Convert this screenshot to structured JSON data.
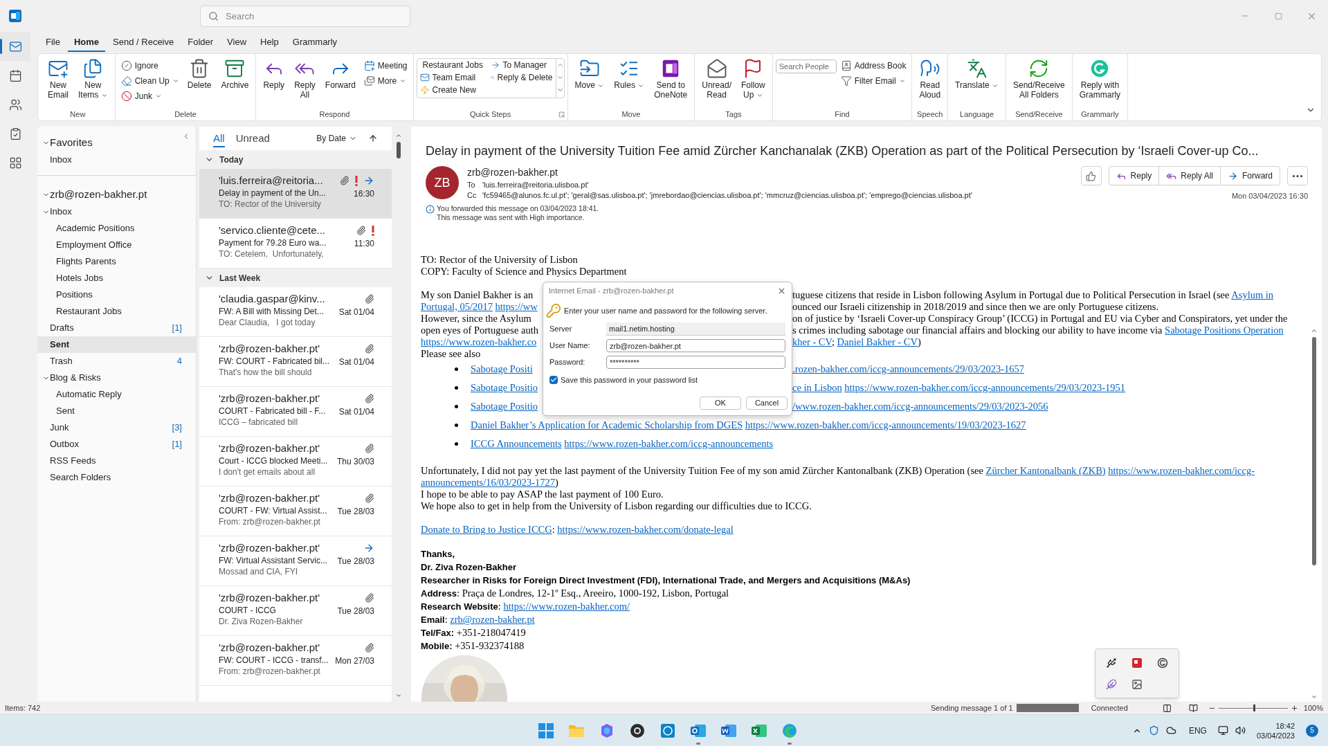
{
  "title_bar": {
    "search": {
      "placeholder": "Search"
    }
  },
  "app_rail": [
    {
      "selected": true
    },
    {
      "selected": false
    },
    {
      "selected": false
    },
    {
      "selected": false
    },
    {
      "selected": false
    }
  ],
  "menu_tabs": [
    {
      "label": "File",
      "selected": false
    },
    {
      "label": "Home",
      "selected": true
    },
    {
      "label": "Send / Receive",
      "selected": false
    },
    {
      "label": "Folder",
      "selected": false
    },
    {
      "label": "View",
      "selected": false
    },
    {
      "label": "Help",
      "selected": false
    },
    {
      "label": "Grammarly",
      "selected": false
    }
  ],
  "ribbon": [
    {
      "label": "New",
      "items": [
        {
          "kind": "large",
          "label": "New\nEmail"
        },
        {
          "kind": "large",
          "label": "New\nItems",
          "dropdown": true
        }
      ]
    },
    {
      "label": "Delete",
      "items": [
        {
          "kind": "stack",
          "buttons": [
            {
              "label": "Ignore"
            },
            {
              "label": "Clean Up",
              "dropdown": true
            },
            {
              "label": "Junk",
              "dropdown": true
            }
          ]
        },
        {
          "kind": "large",
          "label": "Delete"
        },
        {
          "kind": "large",
          "label": "Archive"
        }
      ]
    },
    {
      "label": "Respond",
      "items": [
        {
          "kind": "large",
          "label": "Reply"
        },
        {
          "kind": "large",
          "label": "Reply\nAll"
        },
        {
          "kind": "large",
          "label": "Forward"
        },
        {
          "kind": "stack",
          "buttons": [
            {
              "label": "Meeting"
            },
            {
              "label": "More",
              "dropdown": true
            }
          ]
        }
      ]
    },
    {
      "label": "Quick Steps",
      "launcher": true,
      "items": [
        {
          "kind": "gallery",
          "cells": [
            {
              "label": "Restaurant Jobs"
            },
            {
              "label": "To Manager"
            },
            {
              "label": "Team Email"
            },
            {
              "label": "Reply & Delete"
            },
            {
              "label": "Create New"
            }
          ]
        }
      ]
    },
    {
      "label": "Move",
      "items": [
        {
          "kind": "large",
          "label": "Move",
          "dropdown": true
        },
        {
          "kind": "large",
          "label": "Rules",
          "dropdown": true
        },
        {
          "kind": "large",
          "label": "Send to\nOneNote"
        }
      ]
    },
    {
      "label": "Tags",
      "items": [
        {
          "kind": "large",
          "label": "Unread/\nRead"
        },
        {
          "kind": "large",
          "label": "Follow\nUp",
          "dropdown": true
        }
      ]
    },
    {
      "label": "Find",
      "items": [
        {
          "kind": "search",
          "placeholder": "Search People"
        },
        {
          "kind": "stack",
          "buttons": [
            {
              "label": "Address Book"
            },
            {
              "label": "Filter Email",
              "dropdown": true
            }
          ]
        }
      ]
    },
    {
      "label": "Speech",
      "items": [
        {
          "kind": "large",
          "label": "Read\nAloud"
        }
      ]
    },
    {
      "label": "Language",
      "items": [
        {
          "kind": "large",
          "label": "Translate",
          "dropdown": true
        }
      ]
    },
    {
      "label": "Send/Receive",
      "items": [
        {
          "kind": "large",
          "label": "Send/Receive\nAll Folders"
        }
      ]
    },
    {
      "label": "Grammarly",
      "items": [
        {
          "kind": "large",
          "label": "Reply with\nGrammarly"
        }
      ]
    }
  ],
  "folders": {
    "sections": [
      {
        "label": "Favorites",
        "expanded": true,
        "children": [
          {
            "label": "Inbox",
            "selected": false
          }
        ]
      },
      {
        "label": "zrb@rozen-bakher.pt",
        "expanded": true,
        "children": [
          {
            "label": "Inbox",
            "selected": false,
            "expanded": true,
            "children": [
              {
                "label": "Academic Positions",
                "selected": false
              },
              {
                "label": "Employment Office",
                "selected": false
              },
              {
                "label": "Flights Parents",
                "selected": false
              },
              {
                "label": "Hotels Jobs",
                "selected": false
              },
              {
                "label": "Positions",
                "selected": false
              },
              {
                "label": "Restaurant Jobs",
                "selected": false
              }
            ]
          },
          {
            "label": "Drafts",
            "count": "[1]",
            "selected": false
          },
          {
            "label": "Sent",
            "selected": true
          },
          {
            "label": "Trash",
            "count": "4",
            "selected": false
          },
          {
            "label": "Blog & Risks",
            "selected": false,
            "expanded": true,
            "children": [
              {
                "label": "Automatic Reply",
                "selected": false
              },
              {
                "label": "Sent",
                "selected": false
              }
            ]
          },
          {
            "label": "Junk",
            "count": "[3]",
            "selected": false
          },
          {
            "label": "Outbox",
            "count": "[1]",
            "selected": false
          },
          {
            "label": "RSS Feeds",
            "selected": false
          },
          {
            "label": "Search Folders",
            "selected": false
          }
        ]
      }
    ]
  },
  "message_list": {
    "filters": [
      {
        "label": "All",
        "selected": true
      },
      {
        "label": "Unread",
        "selected": false
      }
    ],
    "sort": "By Date",
    "groups": [
      {
        "label": "Today",
        "expanded": true,
        "messages": [
          {
            "sender": "'luis.ferreira@reitoria...",
            "subject": "Delay in payment of the Un...",
            "preview": "TO: Rector of the University",
            "time": "16:30",
            "attachment": true,
            "important": true,
            "forwarded": true,
            "selected": true
          },
          {
            "sender": "'servico.cliente@cete...",
            "subject": "Payment for 79.28 Euro wa...",
            "preview": "TO: Cetelem,  Unfortunately,",
            "time": "11:30",
            "attachment": true,
            "important": true,
            "forwarded": false,
            "selected": false
          }
        ]
      },
      {
        "label": "Last Week",
        "expanded": true,
        "messages": [
          {
            "sender": "'claudia.gaspar@kinv...",
            "subject": "FW: A Bill with Missing Det...",
            "preview": "Dear Claudia,   I got today",
            "time": "Sat 01/04",
            "attachment": true,
            "important": false,
            "forwarded": false,
            "selected": false
          },
          {
            "sender": "'zrb@rozen-bakher.pt'",
            "subject": "FW: COURT - Fabricated bil...",
            "preview": "That's how the bill should",
            "time": "Sat 01/04",
            "attachment": true,
            "important": false,
            "forwarded": false,
            "selected": false
          },
          {
            "sender": "'zrb@rozen-bakher.pt'",
            "subject": "COURT - Fabricated bill - F...",
            "preview": "ICCG – fabricated bill",
            "time": "Sat 01/04",
            "attachment": true,
            "important": false,
            "forwarded": false,
            "selected": false
          },
          {
            "sender": "'zrb@rozen-bakher.pt'",
            "subject": "Court - ICCG blocked Meeti...",
            "preview": "I don't get emails about all",
            "time": "Thu 30/03",
            "attachment": true,
            "important": false,
            "forwarded": false,
            "selected": false
          },
          {
            "sender": "'zrb@rozen-bakher.pt'",
            "subject": "COURT - FW: Virtual Assist...",
            "preview": "From: zrb@rozen-bakher.pt",
            "time": "Tue 28/03",
            "attachment": true,
            "important": false,
            "forwarded": false,
            "selected": false
          },
          {
            "sender": "'zrb@rozen-bakher.pt'",
            "subject": "FW: Virtual Assistant Servic...",
            "preview": "Mossad and CIA, FYI",
            "time": "Tue 28/03",
            "attachment": false,
            "important": false,
            "forwarded": true,
            "selected": false
          },
          {
            "sender": "'zrb@rozen-bakher.pt'",
            "subject": "COURT - ICCG",
            "preview": "Dr. Ziva Rozen-Bakher",
            "time": "Tue 28/03",
            "attachment": true,
            "important": false,
            "forwarded": false,
            "selected": false
          },
          {
            "sender": "'zrb@rozen-bakher.pt'",
            "subject": "FW: COURT - ICCG - transf...",
            "preview": "From: zrb@rozen-bakher.pt",
            "time": "Mon 27/03",
            "attachment": true,
            "important": false,
            "forwarded": false,
            "selected": false
          }
        ]
      }
    ]
  },
  "reading_pane": {
    "subject": "Delay in payment of the University Tuition Fee amid Zürcher Kanchanalak (ZKB) Operation as part of the Political Persecution by ‘Israeli Cover-up Co...",
    "avatar": "ZB",
    "from": "zrb@rozen-bakher.pt",
    "to_label": "To",
    "to": "'luis.ferreira@reitoria.ulisboa.pt'",
    "cc_label": "Cc",
    "cc": "'fc59465@alunos.fc.ul.pt'; 'geral@sas.ulisboa.pt'; 'jmrebordao@ciencias.ulisboa.pt'; 'mmcruz@ciencias.ulisboa.pt'; 'emprego@ciencias.ulisboa.pt'",
    "date": "Mon 03/04/2023 16:30",
    "info": [
      "You forwarded this message on 03/04/2023 18:41.",
      "This message was sent with High importance."
    ],
    "actions": [
      {
        "label": "Reply"
      },
      {
        "label": "Reply All"
      },
      {
        "label": "Forward"
      }
    ],
    "body": [
      {
        "kind": "line",
        "left": [
          {
            "kind": "plain",
            "t": "TO: Rector of the University of Lisbon"
          }
        ]
      },
      {
        "kind": "line",
        "left": [
          {
            "kind": "plain",
            "t": "COPY: Faculty of Science and Physics Department"
          }
        ]
      },
      {
        "kind": "gap"
      },
      {
        "kind": "line",
        "left": [
          {
            "kind": "plain",
            "t": "My son Daniel Bakher is an"
          }
        ],
        "right": [
          {
            "kind": "plain",
            "t": "tuguese citizens that reside in Lisbon following Asylum in Portugal due to Political Persecution in Israel (see "
          },
          {
            "kind": "link",
            "t": "Asylum in"
          }
        ]
      },
      {
        "kind": "line",
        "left": [
          {
            "kind": "link",
            "t": "Portugal, 05/2017"
          },
          {
            "kind": "link",
            "t": "https://ww"
          }
        ],
        "right": [
          {
            "kind": "plain",
            "t": "ounced our Israeli citizenship in 2018/2019 and since then we are only Portuguese citizens."
          }
        ]
      },
      {
        "kind": "line",
        "left": [
          {
            "kind": "plain",
            "t": "However, since the Asylum"
          }
        ],
        "right": [
          {
            "kind": "plain",
            "t": "on of justice by ‘Israeli Cover-up Conspiracy Group’ (ICCG) in Portugal and EU via Cyber and Conspirators, yet under the"
          }
        ]
      },
      {
        "kind": "line",
        "left": [
          {
            "kind": "plain",
            "t": "open eyes of Portuguese auth"
          }
        ],
        "right": [
          {
            "kind": "plain",
            "t": "s crimes including sabotage our financial affairs and blocking our ability to have income via "
          },
          {
            "kind": "link",
            "t": "Sabotage Positions Operation"
          }
        ]
      },
      {
        "kind": "line",
        "left": [
          {
            "kind": "link",
            "t": "https://www.rozen-bakher.co"
          }
        ],
        "right": [
          {
            "kind": "link",
            "t": "kher - CV"
          },
          {
            "kind": "plain",
            "t": "; "
          },
          {
            "kind": "link",
            "t": "Daniel Bakher - CV"
          },
          {
            "kind": "plain",
            "t": ")"
          }
        ]
      },
      {
        "kind": "line",
        "left": [
          {
            "kind": "plain",
            "t": "Please see also"
          }
        ]
      },
      {
        "kind": "bullet",
        "left": [
          {
            "kind": "link",
            "t": "Sabotage Positi"
          }
        ],
        "right": [
          {
            "kind": "link",
            "t": ".rozen-bakher.com/iccg-announcements/29/03/2023-1657"
          }
        ]
      },
      {
        "kind": "bullet",
        "left": [
          {
            "kind": "link",
            "t": "Sabotage Positio"
          }
        ],
        "right": [
          {
            "kind": "link",
            "t": "ce in Lisbon"
          },
          {
            "kind": "link",
            "t": "https://www.rozen-bakher.com/iccg-announcements/29/03/2023-1951"
          }
        ]
      },
      {
        "kind": "bullet",
        "left": [
          {
            "kind": "link",
            "t": "Sabotage Positio"
          }
        ],
        "right": [
          {
            "kind": "link",
            "t": "/www.rozen-bakher.com/iccg-announcements/29/03/2023-2056"
          }
        ]
      },
      {
        "kind": "bullet",
        "left": [
          {
            "kind": "link",
            "t": "Daniel Bakher’s Application for Academic Scholarship from DGES"
          },
          {
            "kind": "link",
            "t": "https://www.rozen-bakher.com/iccg-announcements/19/03/2023-1627"
          }
        ]
      },
      {
        "kind": "bullet",
        "left": [
          {
            "kind": "link",
            "t": "ICCG Announcements"
          },
          {
            "kind": "link",
            "t": "https://www.rozen-bakher.com/iccg-announcements"
          }
        ]
      },
      {
        "kind": "gap"
      },
      {
        "kind": "line",
        "left": [
          {
            "kind": "plain",
            "t": "Unfortunately, I did not pay yet the last payment of the University Tuition Fee of my son amid Zürcher Kantonalbank (ZKB) Operation (see "
          },
          {
            "kind": "link",
            "t": "Zürcher Kantonalbank (ZKB)"
          },
          {
            "kind": "link",
            "t": "https://www.rozen-bakher.com/iccg-"
          }
        ]
      },
      {
        "kind": "line",
        "left": [
          {
            "kind": "link",
            "t": "announcements/16/03/2023-1727"
          },
          {
            "kind": "plain",
            "t": ")"
          }
        ]
      },
      {
        "kind": "line",
        "left": [
          {
            "kind": "plain",
            "t": "I hope to be able to pay ASAP the last payment of 100 Euro."
          }
        ]
      },
      {
        "kind": "line",
        "left": [
          {
            "kind": "plain",
            "t": "We hope also to get in help from the University of Lisbon regarding our difficulties due to ICCG."
          }
        ]
      },
      {
        "kind": "gap"
      },
      {
        "kind": "line",
        "left": [
          {
            "kind": "link",
            "t": "Donate to Bring to Justice ICCG"
          },
          {
            "kind": "plain",
            "t": ": "
          },
          {
            "kind": "link",
            "t": "https://www.rozen-bakher.com/donate-legal"
          }
        ]
      },
      {
        "kind": "gap"
      },
      {
        "kind": "signature",
        "left": [
          {
            "kind": "bold",
            "t": "Thanks,"
          }
        ]
      },
      {
        "kind": "signature",
        "left": [
          {
            "kind": "bold",
            "t": "Dr. Ziva Rozen-Bakher"
          }
        ]
      },
      {
        "kind": "signature",
        "left": [
          {
            "kind": "bold",
            "t": "Researcher in Risks for Foreign Direct Investment (FDI), International Trade, and Mergers and Acquisitions (M&As)"
          }
        ]
      },
      {
        "kind": "signature",
        "left": [
          {
            "kind": "bold",
            "t": "Address"
          },
          {
            "kind": "plain",
            "t": ": Praça de Londres, 12-1º Esq., Areeiro, 1000-192, Lisbon, Portugal"
          }
        ]
      },
      {
        "kind": "signature",
        "left": [
          {
            "kind": "bold",
            "t": "Research Website"
          },
          {
            "kind": "plain",
            "t": ": "
          },
          {
            "kind": "link",
            "t": "https://www.rozen-bakher.com/"
          }
        ]
      },
      {
        "kind": "signature",
        "left": [
          {
            "kind": "bold",
            "t": "Email"
          },
          {
            "kind": "plain",
            "t": ": "
          },
          {
            "kind": "link",
            "t": "zrb@rozen-bakher.pt"
          }
        ]
      },
      {
        "kind": "signature",
        "left": [
          {
            "kind": "bold",
            "t": "Tel/Fax:"
          },
          {
            "kind": "plain",
            "t": " +351-218047419"
          }
        ]
      },
      {
        "kind": "signature",
        "left": [
          {
            "kind": "bold",
            "t": "Mobile:"
          },
          {
            "kind": "plain",
            "t": " +351-932374188"
          }
        ]
      },
      {
        "kind": "picture"
      }
    ]
  },
  "dialog": {
    "title": "Internet Email - zrb@rozen-bakher.pt",
    "message": "Enter your user name and password for the following server.",
    "fields": [
      {
        "label": "Server",
        "value": "mail1.netim.hosting",
        "kind": "readonly"
      },
      {
        "label": "User Name:",
        "value": "zrb@rozen-bakher.pt",
        "kind": "input"
      },
      {
        "label": "Password:",
        "value": "**********",
        "kind": "input"
      }
    ],
    "save_password": {
      "label": "Save this password in your password list",
      "checked": true
    },
    "buttons": [
      {
        "label": "OK"
      },
      {
        "label": "Cancel"
      }
    ]
  },
  "status_bar": {
    "items": "Items: 742",
    "sending": "Sending message 1 of 1",
    "progress": {
      "level": 1
    },
    "connection": "Connected",
    "zoom": {
      "level": 0.5,
      "reading": "100%"
    }
  },
  "taskbar": {
    "apps": [
      {
        "running": false
      },
      {
        "running": false
      },
      {
        "running": false
      },
      {
        "running": false
      },
      {
        "running": false
      },
      {
        "running": true
      },
      {
        "running": false
      },
      {
        "running": false
      },
      {
        "running": true
      }
    ],
    "language": "ENG",
    "time": "18:42",
    "date": "03/04/2023",
    "notifications": "5"
  }
}
